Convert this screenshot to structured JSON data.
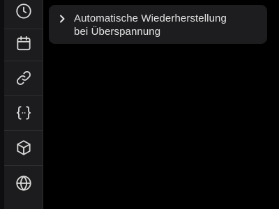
{
  "toolbar": {
    "items": [
      {
        "icon": "clock-icon"
      },
      {
        "icon": "calendar-icon"
      },
      {
        "icon": "link-icon"
      },
      {
        "icon": "curly-braces-icon"
      },
      {
        "icon": "cube-icon"
      },
      {
        "icon": "globe-icon"
      }
    ]
  },
  "accordion": {
    "label_line1": "Automatische Wiederherstellung",
    "label_line2": "bei Überspannung",
    "state": "collapsed"
  },
  "colors": {
    "toolbar_bg": "#1c1c1e",
    "panel_bg": "#000000",
    "accordion_bg": "#1d1d20",
    "text": "#e4e4e4"
  }
}
